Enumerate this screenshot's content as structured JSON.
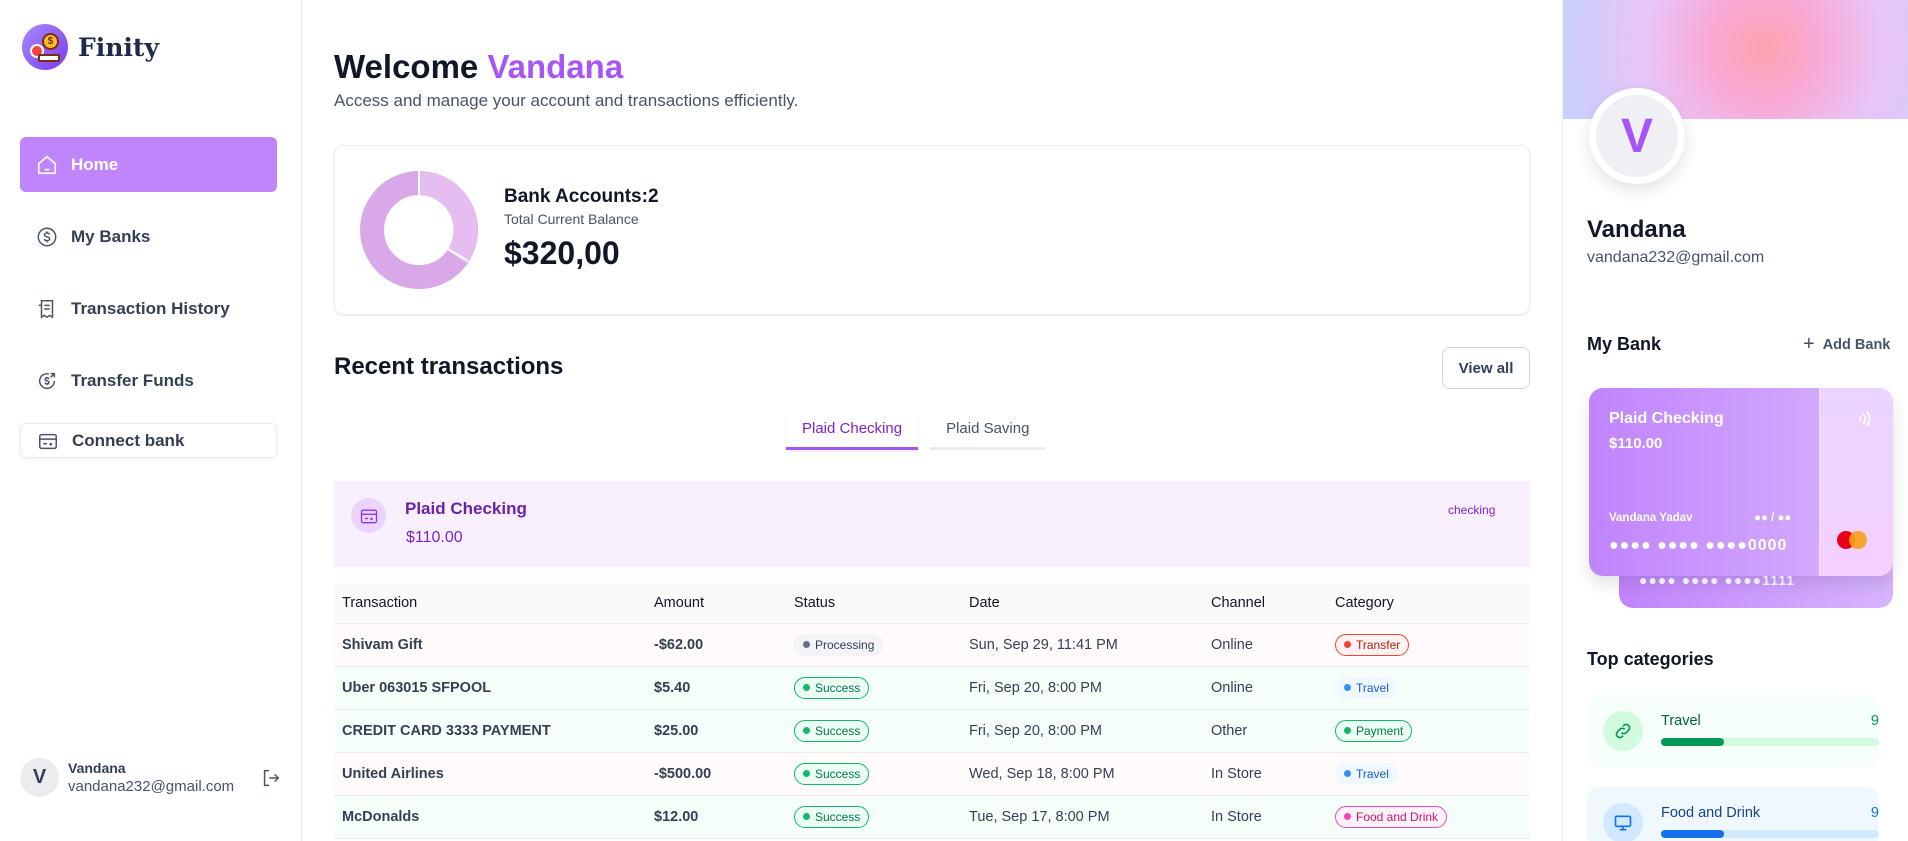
{
  "brand": {
    "name": "Finity"
  },
  "sidebar": {
    "items": [
      {
        "label": "Home",
        "icon": "home-icon",
        "active": true
      },
      {
        "label": "My Banks",
        "icon": "dollar-circle-icon"
      },
      {
        "label": "Transaction History",
        "icon": "receipt-icon"
      },
      {
        "label": "Transfer Funds",
        "icon": "money-send-icon"
      },
      {
        "label": "Connect bank",
        "icon": "connect-bank-icon"
      }
    ],
    "footer": {
      "avatar_initial": "V",
      "name": "Vandana",
      "email": "vandana232@gmail.com"
    }
  },
  "header": {
    "greeting": "Welcome",
    "user": "Vandana",
    "subtitle": "Access and manage your account and transactions efficiently."
  },
  "balance": {
    "accounts_label": "Bank Accounts:",
    "accounts_count": "2",
    "total_label": "Total Current Balance",
    "total": "$320,00",
    "donut_colors": [
      "#d8a8e8",
      "#e2b8ee"
    ]
  },
  "recent": {
    "title": "Recent transactions",
    "view_all": "View all",
    "tabs": [
      {
        "label": "Plaid Checking",
        "active": true
      },
      {
        "label": "Plaid Saving",
        "active": false
      }
    ],
    "account": {
      "name": "Plaid Checking",
      "balance": "$110.00",
      "type": "checking"
    },
    "columns": [
      "Transaction",
      "Amount",
      "Status",
      "Date",
      "Channel",
      "Category"
    ],
    "rows": [
      {
        "name": "Shivam Gift",
        "amount": "-$62.00",
        "status": "Processing",
        "date": "Sun, Sep 29, 11:41 PM",
        "channel": "Online",
        "category": "Transfer",
        "kind": "debit",
        "status_style": "processing",
        "cat_style": "transfer"
      },
      {
        "name": "Uber 063015 SFPOOL",
        "amount": "$5.40",
        "status": "Success",
        "date": "Fri, Sep 20, 8:00 PM",
        "channel": "Online",
        "category": "Travel",
        "kind": "credit",
        "status_style": "success",
        "cat_style": "travel"
      },
      {
        "name": "CREDIT CARD 3333 PAYMENT",
        "amount": "$25.00",
        "status": "Success",
        "date": "Fri, Sep 20, 8:00 PM",
        "channel": "Other",
        "category": "Payment",
        "kind": "credit",
        "status_style": "success",
        "cat_style": "payment"
      },
      {
        "name": "United Airlines",
        "amount": "-$500.00",
        "status": "Success",
        "date": "Wed, Sep 18, 8:00 PM",
        "channel": "In Store",
        "category": "Travel",
        "kind": "debit",
        "status_style": "success",
        "cat_style": "travel"
      },
      {
        "name": "McDonalds",
        "amount": "$12.00",
        "status": "Success",
        "date": "Tue, Sep 17, 8:00 PM",
        "channel": "In Store",
        "category": "Food and Drink",
        "kind": "credit",
        "status_style": "success",
        "cat_style": "food"
      }
    ]
  },
  "profile": {
    "initial": "V",
    "name": "Vandana",
    "email": "vandana232@gmail.com"
  },
  "my_bank": {
    "title": "My Bank",
    "add_label": "Add Bank",
    "card": {
      "name": "Plaid Checking",
      "balance": "$110.00",
      "holder": "Vandana Yadav",
      "expiry": "●● / ●●",
      "number": "●●●● ●●●● ●●●●0000"
    },
    "back_card_number": "●●●● ●●●● ●●●●1111"
  },
  "top_categories": {
    "title": "Top categories",
    "items": [
      {
        "name": "Travel",
        "count": "9",
        "fill": 0.29,
        "style": "travel",
        "icon": "link-icon"
      },
      {
        "name": "Food and Drink",
        "count": "9",
        "fill": 0.29,
        "style": "food",
        "icon": "monitor-icon"
      }
    ]
  }
}
